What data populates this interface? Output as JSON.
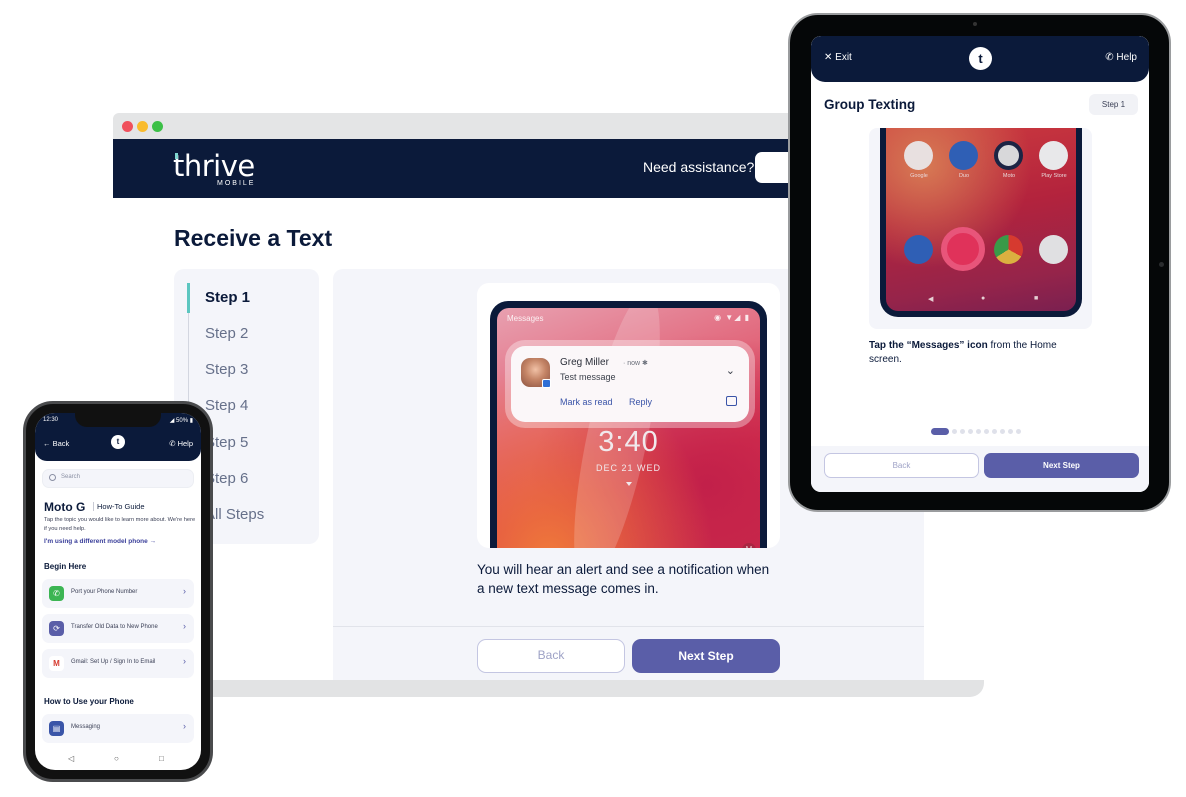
{
  "desktop": {
    "window_controls": [
      "close",
      "minimize",
      "maximize"
    ],
    "header": {
      "logo_word": "thrive",
      "logo_sub": "MOBILE",
      "assist_label": "Need assistance?",
      "assist_button_label": ""
    },
    "page_title": "Receive a Text",
    "steps": [
      {
        "label": "Step 1",
        "active": true
      },
      {
        "label": "Step 2",
        "active": false
      },
      {
        "label": "Step 3",
        "active": false
      },
      {
        "label": "Step 4",
        "active": false
      },
      {
        "label": "Step 5",
        "active": false
      },
      {
        "label": "Step 6",
        "active": false
      },
      {
        "label": "All Steps",
        "active": false
      }
    ],
    "screenshot": {
      "status_app": "Messages",
      "status_icons": "◉ ▼◢ ▮",
      "notification": {
        "sender": "Greg Miller",
        "meta": "· now ✱",
        "message": "Test message",
        "actions": [
          "Mark as read",
          "Reply"
        ],
        "chevron": "⌄"
      },
      "clock": "3:40",
      "date": "DEC  21  WED",
      "badge": "M"
    },
    "description": "You will hear an alert and see a notification when a new text message comes in.",
    "buttons": {
      "back": "Back",
      "next": "Next Step"
    }
  },
  "tablet": {
    "header": {
      "exit": "✕  Exit",
      "logo": "t",
      "help": "✆  Help"
    },
    "title": "Group Texting",
    "step_badge": "Step 1",
    "apps_top": [
      {
        "label": "Google",
        "color": "#e8e0e0"
      },
      {
        "label": "Duo",
        "color": "#2f5fb5"
      },
      {
        "label": "Moto",
        "color": "#d8d8da"
      },
      {
        "label": "Play Store",
        "color": "#e8e8ea"
      }
    ],
    "apps_dock": [
      {
        "name": "phone",
        "color": "#2f5fb5"
      },
      {
        "name": "messages",
        "color": "#3a6ed0"
      },
      {
        "name": "chrome",
        "color": "#dbb040"
      },
      {
        "name": "camera",
        "color": "#e0e0e2"
      }
    ],
    "instruction_bold": "Tap the “Messages” icon",
    "instruction_rest": " from the Home screen.",
    "pagination": {
      "current": 1,
      "total": 10
    },
    "buttons": {
      "back": "Back",
      "next": "Next Step"
    }
  },
  "phone": {
    "status": {
      "time": "12:30",
      "battery": "◢ 50% ▮"
    },
    "header": {
      "back": "← Back",
      "logo": "t",
      "help": "✆ Help"
    },
    "search_placeholder": "Search",
    "title": "Moto G",
    "title_sub": "How-To Guide",
    "description": "Tap the topic you would like to learn more about. We're here if you need help.",
    "link": "I'm using a different model phone →",
    "sections": [
      {
        "title": "Begin Here",
        "items": [
          {
            "label": "Port your Phone Number",
            "icon": "phone-icon",
            "glyph": "✆",
            "color": "#3cb553"
          },
          {
            "label": "Transfer Old Data to New Phone",
            "icon": "sync-icon",
            "glyph": "⟳",
            "color": "#5a5ea8"
          },
          {
            "label": "Gmail: Set Up / Sign In to Email",
            "icon": "gmail-icon",
            "glyph": "M",
            "color": "#ffffff"
          }
        ]
      },
      {
        "title": "How to Use your Phone",
        "items": [
          {
            "label": "Messaging",
            "icon": "message-icon",
            "glyph": "▤",
            "color": "#3a55a8"
          }
        ]
      }
    ],
    "nav": {
      "back": "◁",
      "home": "○",
      "recents": "□"
    }
  }
}
